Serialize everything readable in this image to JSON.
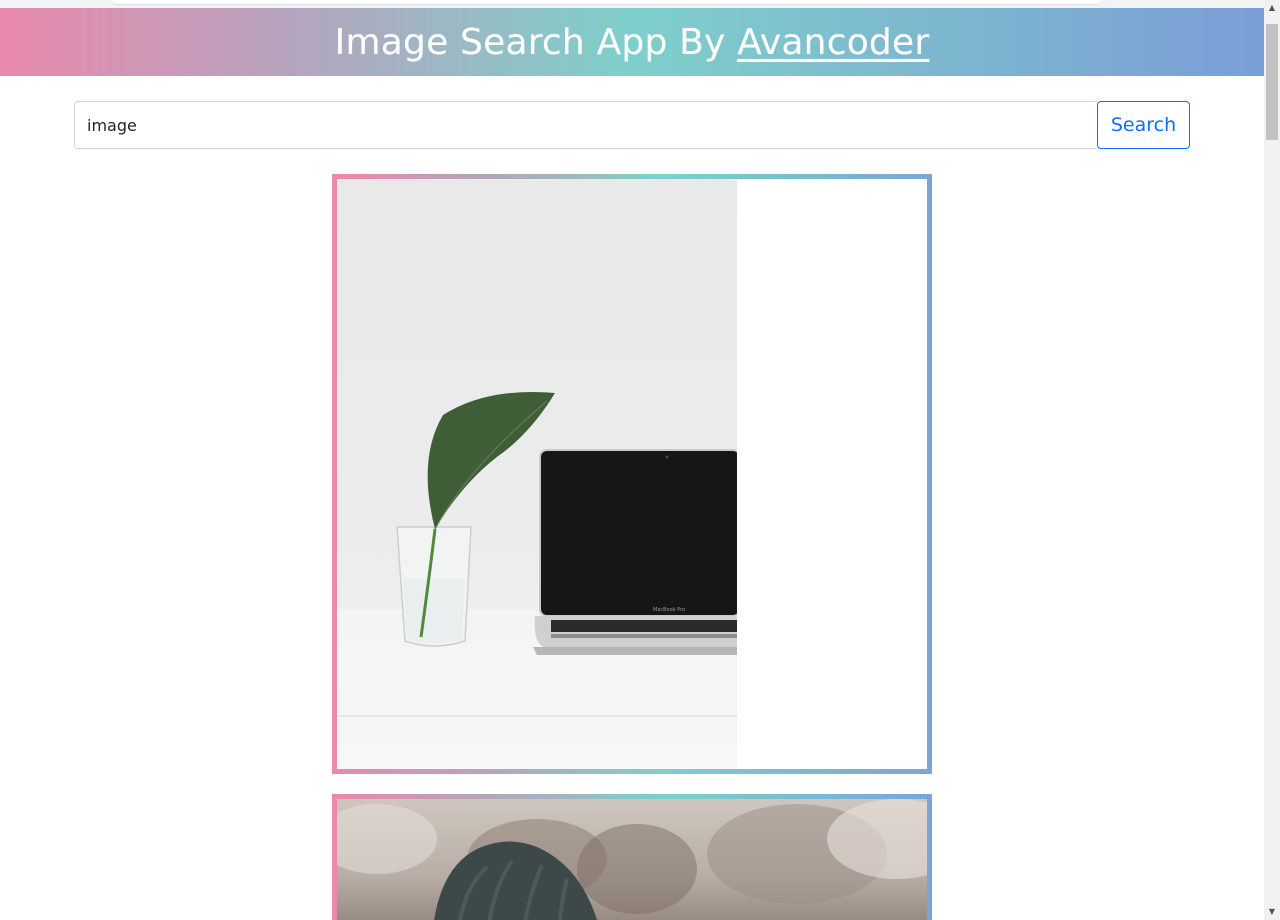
{
  "header": {
    "title_text": "Image Search App By ",
    "author_link": "Avancoder"
  },
  "search": {
    "value": "image",
    "button_label": "Search"
  },
  "results": [
    {
      "icon": "photo-plant-laptop"
    },
    {
      "icon": "photo-beanie-dusk"
    }
  ],
  "colors": {
    "gradient_start": "#e989ad",
    "gradient_mid": "#7ecfcb",
    "gradient_end": "#7a9ed7",
    "button_accent": "#0d6efd"
  },
  "scrollbar": {
    "up_icon": "scroll-up-arrow-icon",
    "down_icon": "scroll-down-arrow-icon"
  }
}
